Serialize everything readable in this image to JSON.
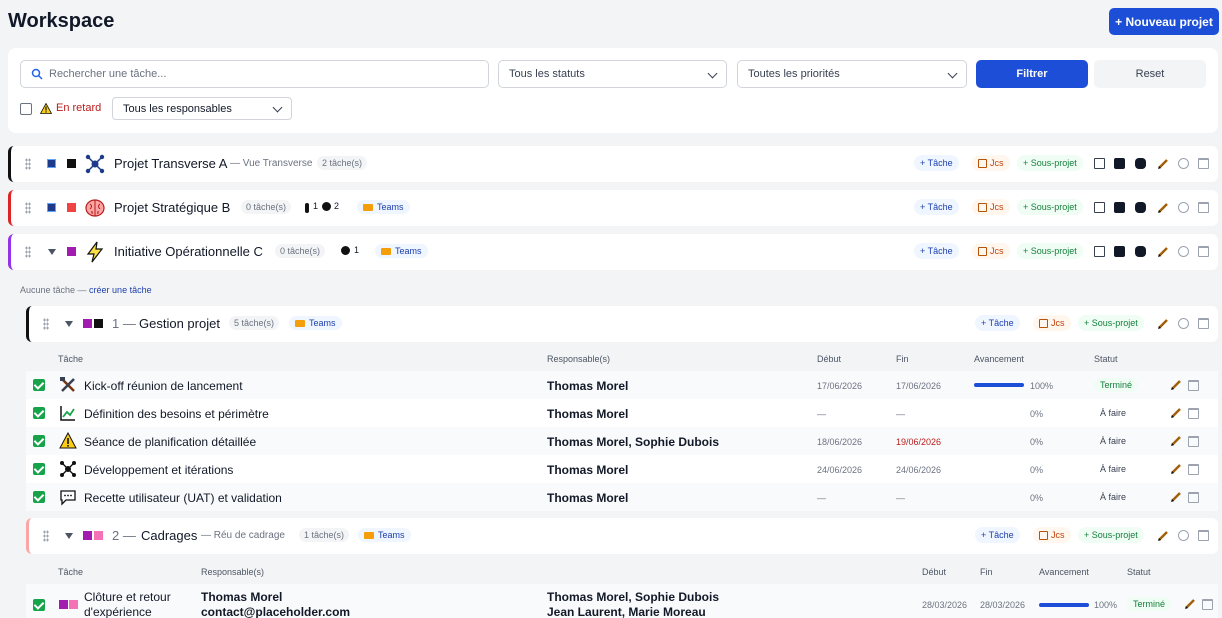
{
  "header": {
    "title": "Workspace",
    "new_project": "+ Nouveau projet"
  },
  "filters": {
    "search_placeholder": "Rechercher une tâche...",
    "status": "Tous les statuts",
    "priority": "Toutes les priorités",
    "filter_btn": "Filtrer",
    "reset_btn": "Reset",
    "late_label": "En retard",
    "responsables": "Tous les responsables"
  },
  "actions": {
    "tache": "+ Tâche",
    "jcs": "Jcs",
    "sous_projet": "+ Sous-projet"
  },
  "projects": [
    {
      "name": "Projet Transverse A",
      "sub": "— Vue Transverse",
      "count": "2 tâche(s)",
      "accent": "#111111",
      "square": "#111111"
    },
    {
      "name": "Projet Stratégique B",
      "count": "0 tâche(s)",
      "badge1": "1",
      "badge2": "2",
      "teams": "Teams",
      "accent": "#dc2626",
      "square": "#ef4444"
    },
    {
      "name": "Initiative Opérationnelle C",
      "count": "0 tâche(s)",
      "badge2": "1",
      "teams": "Teams",
      "accent": "#9333ea",
      "square": "#a21caf"
    }
  ],
  "empty": {
    "text": "Aucune tâche — ",
    "link": "créer une tâche"
  },
  "subprojects": [
    {
      "num": "1 —",
      "name": "Gestion projet",
      "count": "5 tâche(s)",
      "teams": "Teams",
      "accent": "#111111"
    },
    {
      "num": "2 —",
      "name": "Cadrages",
      "sub": "— Réu de cadrage",
      "count": "1 tâche(s)",
      "teams": "Teams",
      "accent": "#fca5a5"
    }
  ],
  "table1": {
    "headers": [
      "Tâche",
      "Responsable(s)",
      "Début",
      "Fin",
      "Avancement",
      "Statut"
    ],
    "rows": [
      {
        "name": "Kick-off réunion de lancement",
        "resp": "Thomas Morel",
        "debut": "17/06/2026",
        "fin": "17/06/2026",
        "progress": 100,
        "pct": "100%",
        "status": "Terminé"
      },
      {
        "name": "Définition des besoins et périmètre",
        "resp": "Thomas Morel",
        "debut": "—",
        "fin": "—",
        "progress": 0,
        "pct": "0%",
        "status": "À faire"
      },
      {
        "name": "Séance de planification détaillée",
        "resp": "Thomas Morel, Sophie Dubois",
        "debut": "18/06/2026",
        "fin": "19/06/2026",
        "progress": 0,
        "pct": "0%",
        "status": "À faire"
      },
      {
        "name": "Développement et itérations",
        "resp": "Thomas Morel",
        "debut": "24/06/2026",
        "fin": "24/06/2026",
        "progress": 0,
        "pct": "0%",
        "status": "À faire"
      },
      {
        "name": "Recette utilisateur (UAT) et validation",
        "resp": "Thomas Morel",
        "debut": "—",
        "fin": "—",
        "progress": 0,
        "pct": "0%",
        "status": "À faire"
      }
    ]
  },
  "table2": {
    "headers": [
      "Tâche",
      "Responsable(s)",
      "Début",
      "Fin",
      "Avancement",
      "Statut"
    ],
    "row": {
      "name1": "Clôture et retour",
      "name2": "d'expérience",
      "resp1": "Thomas Morel",
      "resp2": "contact@placeholder.com",
      "resp3": "Thomas Morel, Sophie Dubois",
      "resp4": "Jean Laurent, Marie Moreau",
      "debut": "28/03/2026",
      "fin": "28/03/2026",
      "progress": 100,
      "pct": "100%",
      "status": "Terminé"
    }
  }
}
